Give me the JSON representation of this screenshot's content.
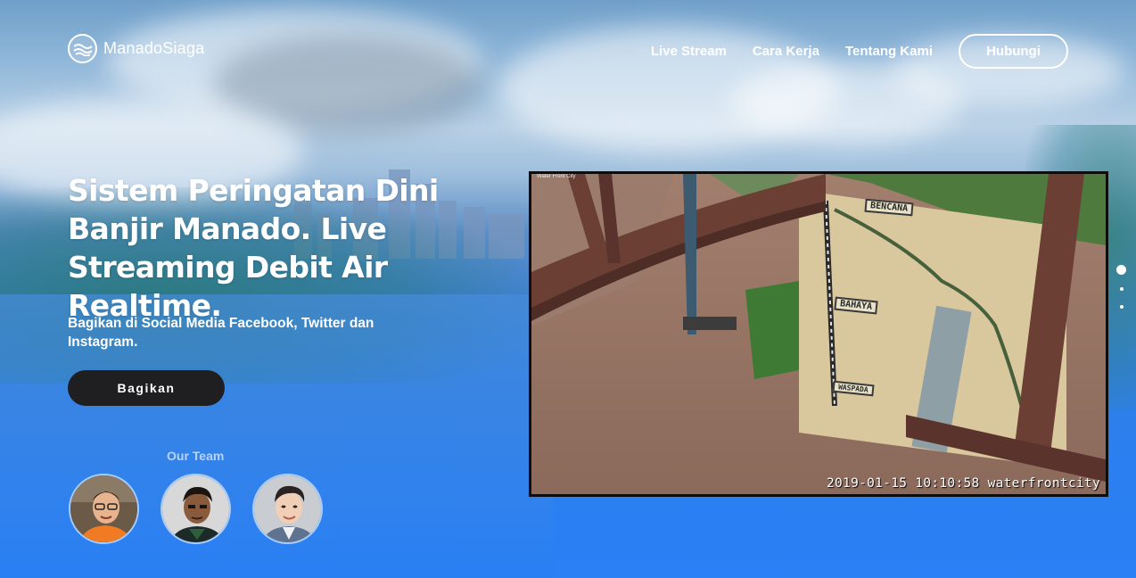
{
  "brand": {
    "name": "ManadoSiaga",
    "logo_icon": "water-waves-icon"
  },
  "nav": {
    "links": [
      "Live Stream",
      "Cara Kerja",
      "Tentang Kami"
    ],
    "cta": "Hubungi"
  },
  "hero": {
    "title": "Sistem Peringatan Dini Banjir Manado. Live Streaming Debit Air Realtime.",
    "subtitle": "Bagikan di Social Media Facebook, Twitter dan Instagram.",
    "share_button": "Bagikan"
  },
  "team": {
    "label": "Our Team",
    "members": [
      {
        "avatar": "team-member-avatar"
      },
      {
        "avatar": "team-member-avatar"
      },
      {
        "avatar": "team-member-avatar"
      }
    ]
  },
  "stream": {
    "camera_name": "Water Front City",
    "timestamp": "2019-01-15 10:10:58 waterfrontcity",
    "signs": {
      "top": "BENCANA",
      "middle": "BAHAYA",
      "bottom": "WASPADA"
    }
  },
  "slider": {
    "count": 3,
    "active_index": 0
  },
  "colors": {
    "accent_blue": "#2a7ff0",
    "button_dark": "#1f1f22",
    "text_white": "#ffffff"
  }
}
